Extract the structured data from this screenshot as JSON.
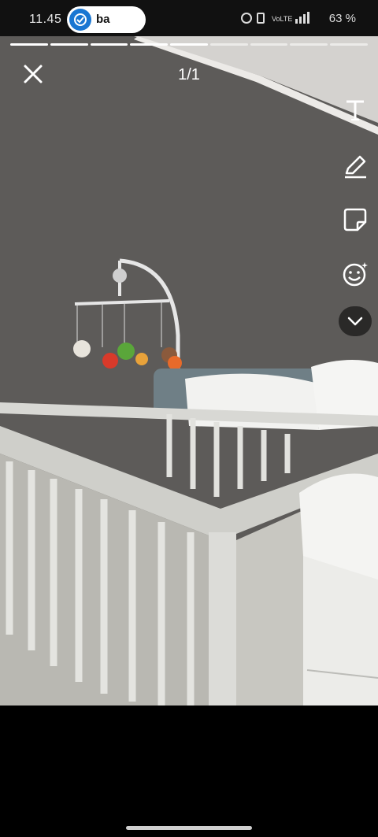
{
  "status_bar": {
    "time": "11.45",
    "app_pill_label": "ba",
    "battery": "63 %"
  },
  "story": {
    "counter": "1/1",
    "segments": 9,
    "completed_segments": 5
  },
  "tools": {
    "text_icon": "text-icon",
    "draw_icon": "pencil-icon",
    "sticker_icon": "sticker-icon",
    "emoji_icon": "emoji-icon",
    "more_icon": "chevron-down-icon"
  },
  "photo": {
    "description_icon": "nursery-photo"
  }
}
